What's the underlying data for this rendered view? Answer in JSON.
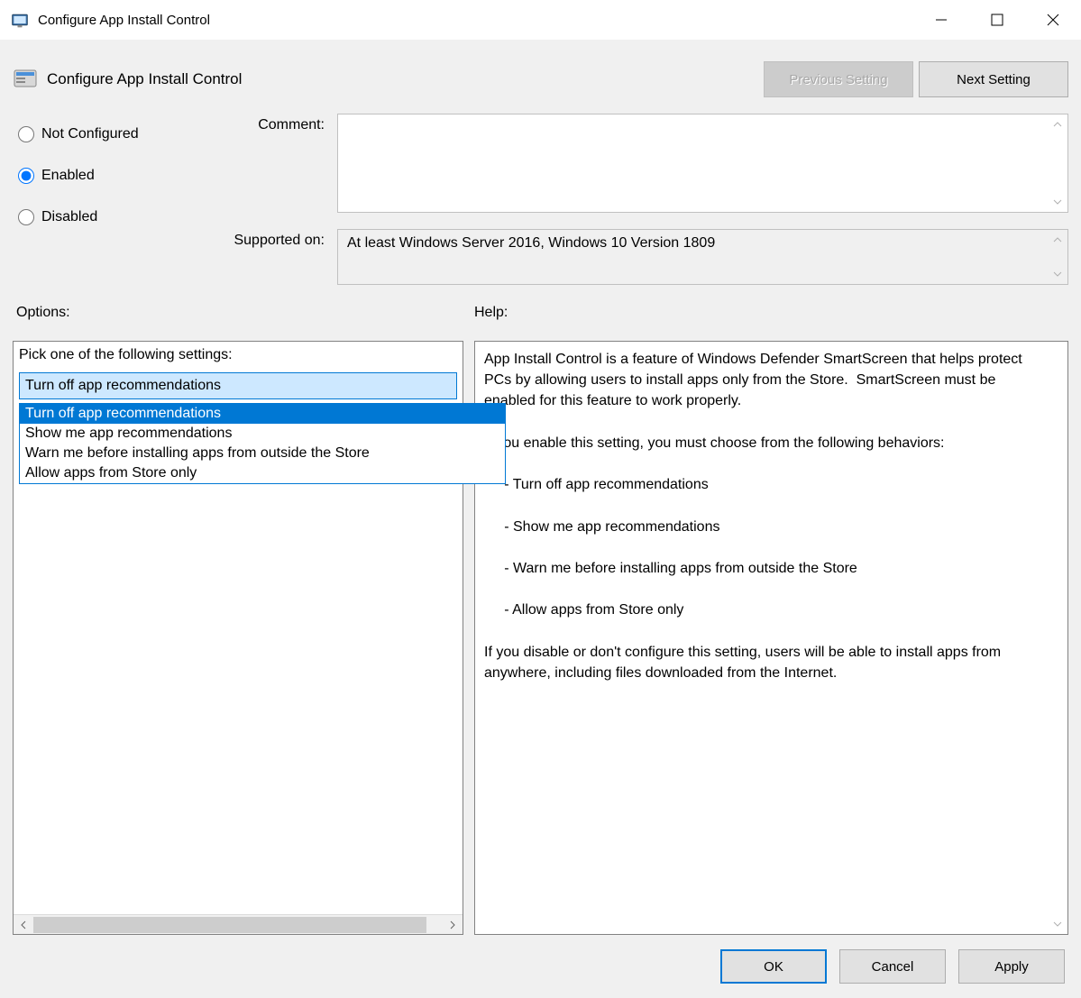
{
  "window_title": "Configure App Install Control",
  "policy_title": "Configure App Install Control",
  "nav": {
    "previous": "Previous Setting",
    "next": "Next Setting"
  },
  "state": {
    "selected_radio": "enabled"
  },
  "radio": {
    "not_configured": "Not Configured",
    "enabled": "Enabled",
    "disabled": "Disabled"
  },
  "labels": {
    "comment": "Comment:",
    "supported_on": "Supported on:",
    "options": "Options:",
    "help": "Help:"
  },
  "comment_value": "",
  "supported_on_value": "At least Windows Server 2016, Windows 10 Version 1809",
  "options_panel": {
    "prompt": "Pick one of the following settings:",
    "selected": "Turn off app recommendations",
    "choices": [
      "Turn off app recommendations",
      "Show me app recommendations",
      "Warn me before installing apps from outside the Store",
      "Allow apps from Store only"
    ]
  },
  "help_text": "App Install Control is a feature of Windows Defender SmartScreen that helps protect PCs by allowing users to install apps only from the Store.  SmartScreen must be enabled for this feature to work properly.\n\nIf you enable this setting, you must choose from the following behaviors:\n\n     - Turn off app recommendations\n\n     - Show me app recommendations\n\n     - Warn me before installing apps from outside the Store\n\n     - Allow apps from Store only\n\nIf you disable or don't configure this setting, users will be able to install apps from anywhere, including files downloaded from the Internet.\n",
  "buttons": {
    "ok": "OK",
    "cancel": "Cancel",
    "apply": "Apply"
  }
}
